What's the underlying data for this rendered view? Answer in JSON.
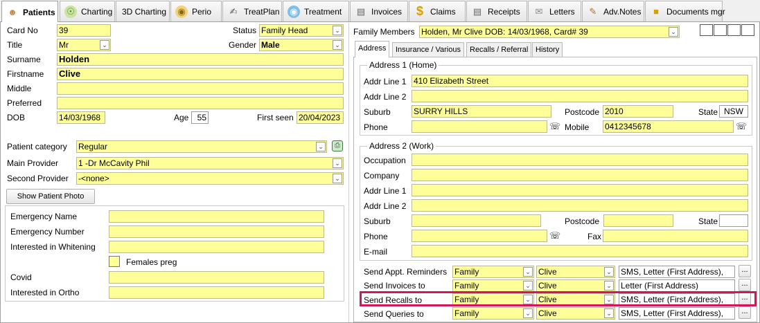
{
  "tabs": [
    {
      "label": "Patients",
      "icon": "patient-icon"
    },
    {
      "label": "Charting",
      "icon": "charting-icon"
    },
    {
      "label": "3D Charting",
      "icon": ""
    },
    {
      "label": "Perio",
      "icon": "perio-icon"
    },
    {
      "label": "TreatPlan",
      "icon": "treatplan-icon"
    },
    {
      "label": "Treatment",
      "icon": "treatment-icon"
    },
    {
      "label": "Invoices",
      "icon": "invoices-icon"
    },
    {
      "label": "Claims",
      "icon": "dollar-icon"
    },
    {
      "label": "Receipts",
      "icon": "receipts-icon"
    },
    {
      "label": "Letters",
      "icon": "envelope-icon"
    },
    {
      "label": "Adv.Notes",
      "icon": "notes-icon"
    },
    {
      "label": "Documents mgr",
      "icon": "folder-icon"
    }
  ],
  "patient": {
    "card_no_label": "Card No",
    "card_no": "39",
    "status_label": "Status",
    "status": "Family Head",
    "title_label": "Title",
    "title": "Mr",
    "gender_label": "Gender",
    "gender": "Male",
    "surname_label": "Surname",
    "surname": "Holden",
    "firstname_label": "Firstname",
    "firstname": "Clive",
    "middle_label": "Middle",
    "middle": "",
    "preferred_label": "Preferred",
    "preferred": "",
    "dob_label": "DOB",
    "dob": "14/03/1968",
    "age_label": "Age",
    "age": "55",
    "first_seen_label": "First seen",
    "first_seen": "20/04/2023",
    "category_label": "Patient category",
    "category": "Regular",
    "main_provider_label": "Main Provider",
    "main_provider": "1 -Dr McCavity Phil",
    "second_provider_label": "Second Provider",
    "second_provider": "-<none>",
    "show_photo_button": "Show Patient Photo"
  },
  "extra": {
    "emergency_name_label": "Emergency Name",
    "emergency_name": "",
    "emergency_number_label": "Emergency Number",
    "emergency_number": "",
    "whitening_label": "Interested in Whitening",
    "whitening": "",
    "females_preg_label": "Females preg",
    "covid_label": "Covid",
    "covid": "",
    "ortho_label": "Interested in Ortho",
    "ortho": ""
  },
  "family": {
    "label": "Family Members",
    "value": "Holden, Mr Clive DOB: 14/03/1968, Card# 39"
  },
  "subtabs": [
    "Address",
    "Insurance / Various",
    "Recalls / Referral",
    "History"
  ],
  "address1": {
    "title": "Address 1 (Home)",
    "line1_label": "Addr Line 1",
    "line1": "410 Elizabeth Street",
    "line2_label": "Addr Line 2",
    "line2": "",
    "suburb_label": "Suburb",
    "suburb": "SURRY HILLS",
    "postcode_label": "Postcode",
    "postcode": "2010",
    "state_label": "State",
    "state": "NSW",
    "phone_label": "Phone",
    "phone": "",
    "mobile_label": "Mobile",
    "mobile": "0412345678"
  },
  "address2": {
    "title": "Address 2 (Work)",
    "occupation_label": "Occupation",
    "occupation": "",
    "company_label": "Company",
    "company": "",
    "line1_label": "Addr Line 1",
    "line1": "",
    "line2_label": "Addr Line 2",
    "line2": "",
    "suburb_label": "Suburb",
    "suburb": "",
    "postcode_label": "Postcode",
    "postcode": "",
    "state_label": "State",
    "state": "",
    "phone_label": "Phone",
    "phone": "",
    "fax_label": "Fax",
    "fax": "",
    "email_label": "E-mail",
    "email": ""
  },
  "send": [
    {
      "label": "Send Appt. Reminders",
      "to": "Family",
      "person": "Clive",
      "method": "SMS, Letter (First Address),"
    },
    {
      "label": "Send Invoices to",
      "to": "Family",
      "person": "Clive",
      "method": "Letter (First Address)"
    },
    {
      "label": "Send Recalls to",
      "to": "Family",
      "person": "Clive",
      "method": "SMS, Letter (First Address),"
    },
    {
      "label": "Send Queries to",
      "to": "Family",
      "person": "Clive",
      "method": "SMS, Letter (First Address),"
    }
  ],
  "ellipsis": "...",
  "colors": {
    "field_bg": "#ffff99",
    "highlight": "#d6145c"
  }
}
